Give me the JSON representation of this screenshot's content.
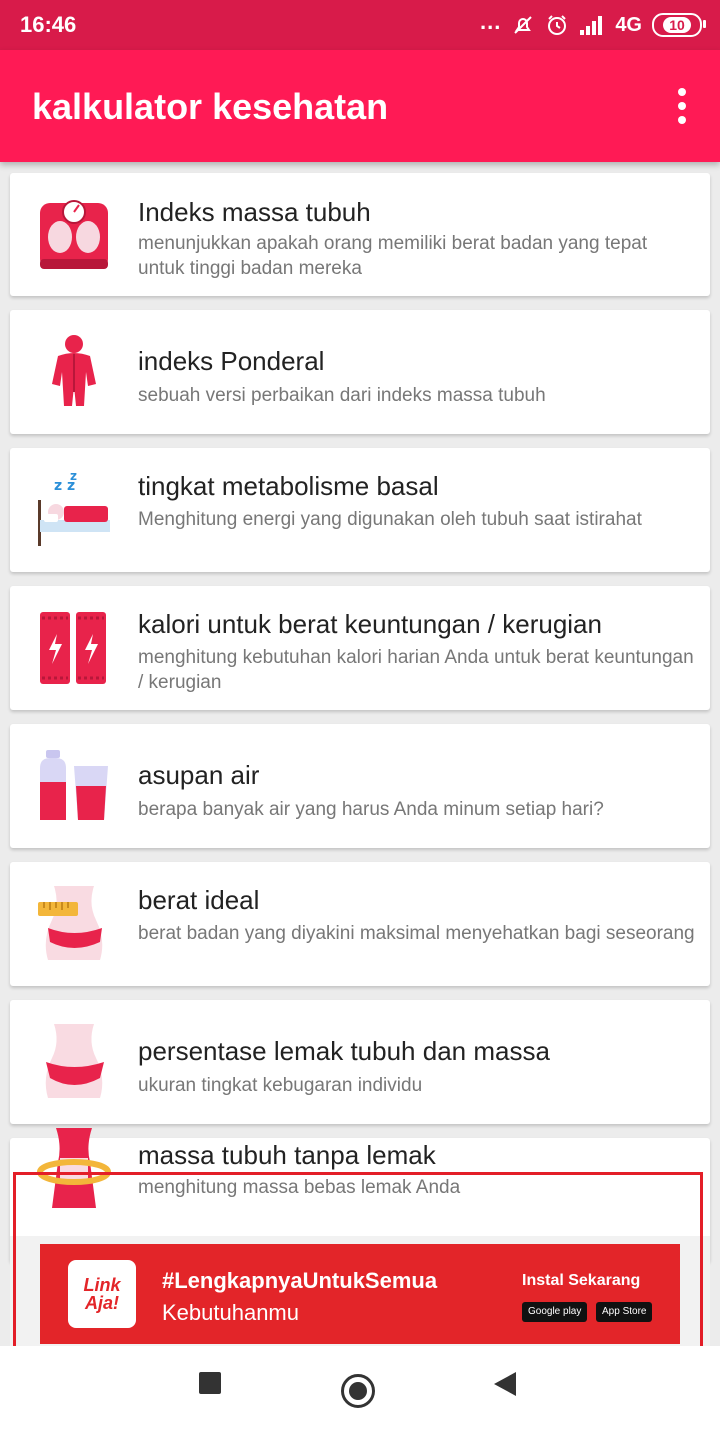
{
  "status_bar": {
    "time": "16:46",
    "dots": "...",
    "network": "4G",
    "battery": "10"
  },
  "app_bar": {
    "title": "kalkulator kesehatan"
  },
  "items": [
    {
      "title": "Indeks massa tubuh",
      "description": "menunjukkan apakah orang memiliki berat badan yang tepat untuk tinggi badan mereka",
      "icon": "weight-scale-icon"
    },
    {
      "title": "indeks Ponderal",
      "description": "sebuah versi perbaikan dari indeks massa tubuh",
      "icon": "body-icon"
    },
    {
      "title": "tingkat metabolisme basal",
      "description": "Menghitung energi yang digunakan oleh tubuh saat istirahat",
      "icon": "sleeping-bed-icon"
    },
    {
      "title": "kalori untuk berat keuntungan / kerugian",
      "description": "menghitung kebutuhan kalori harian Anda untuk berat keuntungan / kerugian",
      "icon": "energy-bars-icon"
    },
    {
      "title": "asupan air",
      "description": "berapa banyak air yang harus Anda minum setiap hari?",
      "icon": "water-bottle-glass-icon"
    },
    {
      "title": "berat ideal",
      "description": "berat badan yang diyakini maksimal menyehatkan bagi seseorang",
      "icon": "waist-measure-icon"
    },
    {
      "title": "persentase lemak tubuh dan massa",
      "description": "ukuran tingkat kebugaran individu",
      "icon": "hips-icon"
    },
    {
      "title": "massa tubuh tanpa lemak",
      "description": "menghitung massa bebas lemak Anda",
      "icon": "waist-hula-icon"
    }
  ],
  "ad": {
    "logo_line1": "Link",
    "logo_line2": "Aja!",
    "headline": "#LengkapnyaUntukSemua",
    "subtext": "Kebutuhanmu",
    "cta": "Instal Sekarang",
    "badge_google": "Google play",
    "badge_apple": "App Store"
  },
  "colors": {
    "status_bar": "#d81b4a",
    "app_bar": "#ff1a55",
    "icon_primary": "#e8234b",
    "ad_red": "#e32529"
  }
}
